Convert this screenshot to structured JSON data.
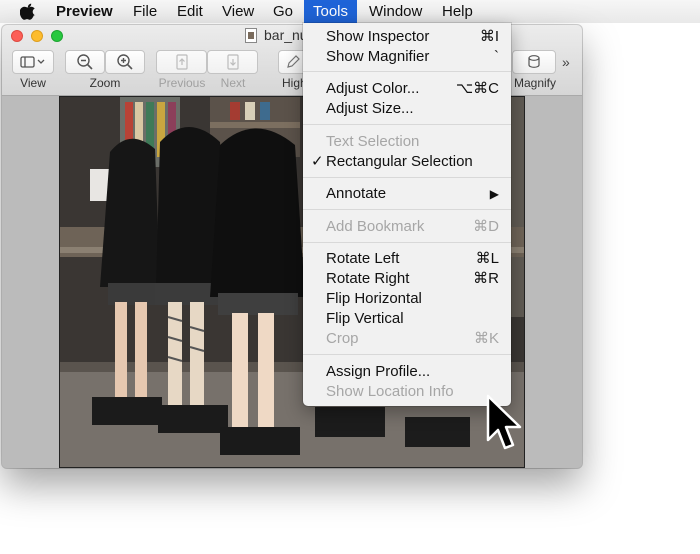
{
  "menubar": {
    "app": "Preview",
    "items": [
      "File",
      "Edit",
      "View",
      "Go",
      "Tools",
      "Window",
      "Help"
    ],
    "active": "Tools"
  },
  "window": {
    "title": "bar_nu",
    "toolbar": {
      "view_label": "View",
      "zoom_label": "Zoom",
      "previous_label": "Previous",
      "next_label": "Next",
      "highlight_label": "High",
      "magnify_label": "Magnify",
      "more_glyph": "»"
    }
  },
  "tools_menu": {
    "show_inspector": {
      "label": "Show Inspector",
      "shortcut": "⌘I"
    },
    "show_magnifier": {
      "label": "Show Magnifier",
      "shortcut": "`"
    },
    "adjust_color": {
      "label": "Adjust Color...",
      "shortcut": "⌥⌘C"
    },
    "adjust_size": {
      "label": "Adjust Size..."
    },
    "text_selection": {
      "label": "Text Selection"
    },
    "rectangular_selection": {
      "label": "Rectangular Selection",
      "checked": "✓"
    },
    "annotate": {
      "label": "Annotate",
      "submenu": "▶"
    },
    "add_bookmark": {
      "label": "Add Bookmark",
      "shortcut": "⌘D"
    },
    "rotate_left": {
      "label": "Rotate Left",
      "shortcut": "⌘L"
    },
    "rotate_right": {
      "label": "Rotate Right",
      "shortcut": "⌘R"
    },
    "flip_horizontal": {
      "label": "Flip Horizontal"
    },
    "flip_vertical": {
      "label": "Flip Vertical"
    },
    "crop": {
      "label": "Crop",
      "shortcut": "⌘K"
    },
    "assign_profile": {
      "label": "Assign Profile..."
    },
    "show_location_info": {
      "label": "Show Location Info"
    }
  },
  "colors": {
    "menu_highlight": "#1f64d8",
    "traffic_close": "#fc5f57",
    "traffic_min": "#fdbc2e",
    "traffic_max": "#28c840"
  },
  "icons": [
    "apple-logo-icon",
    "sidebar-icon",
    "zoom-out-icon",
    "zoom-in-icon",
    "arrow-up-icon",
    "arrow-down-icon",
    "pen-icon",
    "magnifier-icon",
    "arrow-cursor-icon"
  ]
}
